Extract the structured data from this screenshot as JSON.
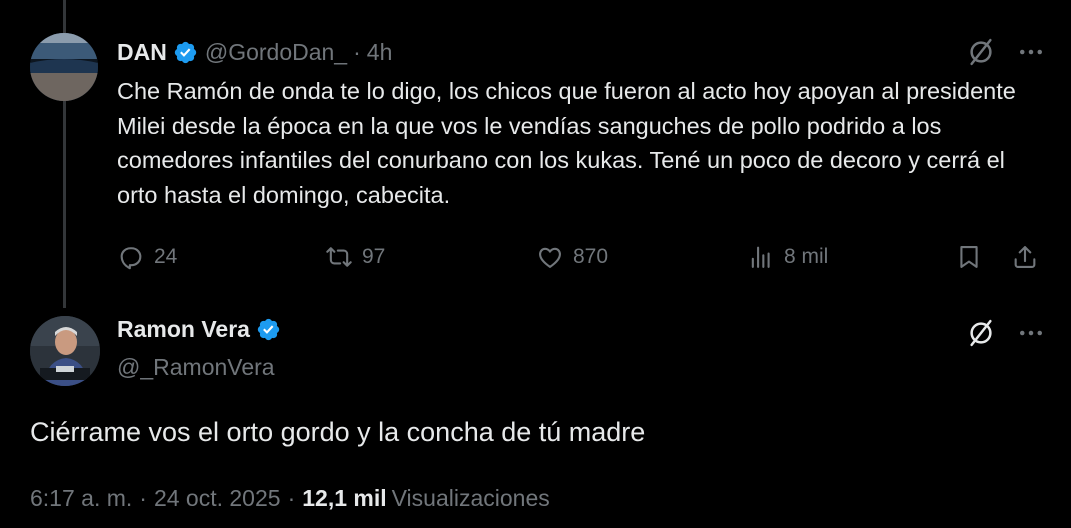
{
  "tweet1": {
    "display_name": "DAN",
    "handle": "@GordoDan_",
    "separator": "·",
    "time": "4h",
    "text": "Che Ramón de onda te lo digo, los chicos que fueron al acto hoy apoyan al presidente Milei desde la época en la que vos le vendías sanguches de pollo podrido a los comedores infantiles del conurbano con los kukas. Tené un poco de decoro y cerrá el orto hasta el domingo, cabecita.",
    "replies": "24",
    "reposts": "97",
    "likes": "870",
    "views": "8 mil"
  },
  "tweet2": {
    "display_name": "Ramon Vera",
    "handle": "@_RamonVera",
    "text": "Ciérrame vos el orto gordo y la concha de tú madre",
    "time": "6:17 a. m.",
    "separator": "·",
    "date": "24 oct. 2025",
    "separator2": "·",
    "views_count": "12,1 mil",
    "views_label": "Visualizaciones"
  },
  "icons": {
    "verified": "verified-badge",
    "grok": "grok-icon",
    "more": "more-icon",
    "reply": "reply-icon",
    "repost": "repost-icon",
    "like": "like-icon",
    "views": "views-icon",
    "bookmark": "bookmark-icon",
    "share": "share-icon"
  },
  "colors": {
    "background": "#000000",
    "text": "#e7e9ea",
    "muted": "#71767b",
    "verified": "#1d9bf0",
    "line": "#333639"
  }
}
